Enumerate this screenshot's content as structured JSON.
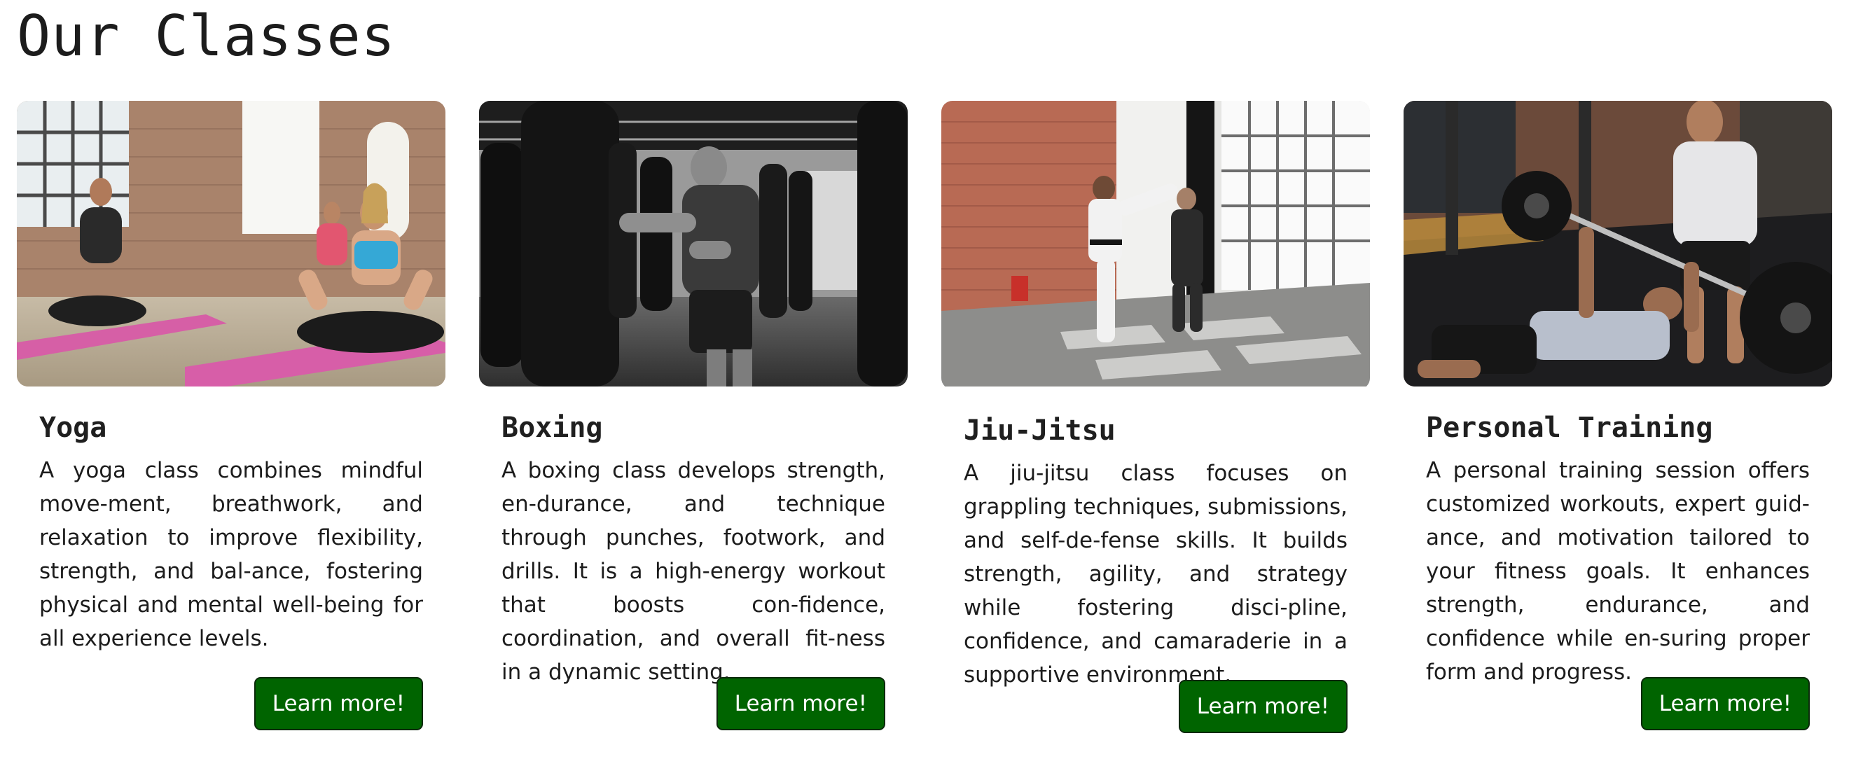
{
  "page": {
    "title": "Our Classes"
  },
  "classes": [
    {
      "name": "Yoga",
      "image_icon": "yoga-photo",
      "description": "A yoga class combines mindful move-ment, breathwork, and relaxation to improve flexibility, strength, and bal-ance, fostering physical and mental well-being for all experience levels.",
      "button_label": "Learn more!"
    },
    {
      "name": "Boxing",
      "image_icon": "boxing-photo",
      "description": "A boxing class develops strength, en-durance, and technique through punches, footwork, and drills. It is a high-energy workout that boosts con-fidence, coordination, and overall fit-ness in a dynamic setting.",
      "button_label": "Learn more!"
    },
    {
      "name": "Jiu-Jitsu",
      "image_icon": "jiu-jitsu-photo",
      "description": "A jiu-jitsu class focuses on grappling techniques, submissions, and self-de-fense skills. It builds strength, agility, and strategy while fostering disci-pline, confidence, and camaraderie in a supportive environment.",
      "button_label": "Learn more!"
    },
    {
      "name": "Personal Training",
      "image_icon": "personal-training-photo",
      "description": "A personal training session offers customized workouts, expert guid-ance, and motivation tailored to your fitness goals. It enhances strength, endurance, and confidence while en-suring proper form and progress.",
      "button_label": "Learn more!"
    }
  ],
  "colors": {
    "button_background": "#006400",
    "button_border": "#0b2a0b",
    "button_text": "#ffffff",
    "background": "#ffffff"
  }
}
